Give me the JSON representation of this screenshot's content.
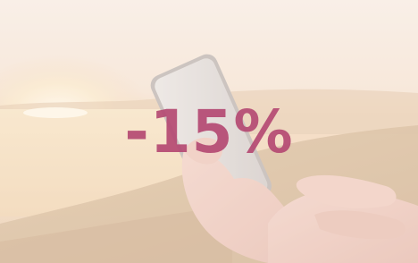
{
  "promo": {
    "discount_text": "-15%",
    "text_color": "#b54a73"
  },
  "photo": {
    "subject": "hands-holding-smartphone-at-sunset"
  }
}
